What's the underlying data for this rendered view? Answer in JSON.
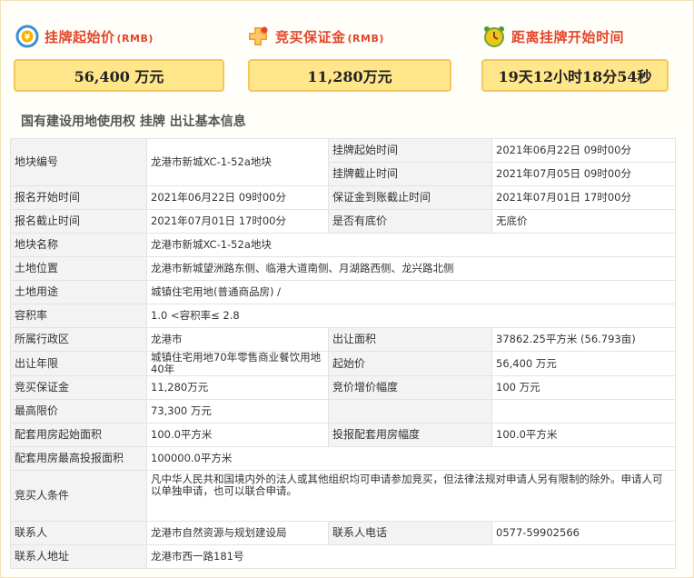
{
  "cards": [
    {
      "title": "挂牌起始价",
      "unit": "(RMB)",
      "value": "56,400 万元",
      "icon": "clock-money-icon"
    },
    {
      "title": "竞买保证金",
      "unit": "(RMB)",
      "value": "11,280万元",
      "icon": "deposit-cross-icon"
    },
    {
      "title": "距离挂牌开始时间",
      "unit": "",
      "value": "19天12小时18分54秒",
      "icon": "alarm-clock-icon"
    }
  ],
  "section_title": "国有建设用地使用权 挂牌 出让基本信息",
  "table": {
    "r1": {
      "l1": "地块编号",
      "v1": "龙港市新城XC-1-52a地块",
      "l2": "挂牌起始时间",
      "v2": "2021年06月22日 09时00分"
    },
    "r2": {
      "l2": "挂牌截止时间",
      "v2": "2021年07月05日 09时00分"
    },
    "r3": {
      "l1": "报名开始时间",
      "v1": "2021年06月22日 09时00分",
      "l2": "保证金到账截止时间",
      "v2": "2021年07月01日 17时00分"
    },
    "r4": {
      "l1": "报名截止时间",
      "v1": "2021年07月01日 17时00分",
      "l2": "是否有底价",
      "v2": "无底价"
    },
    "r5": {
      "l1": "地块名称",
      "v1": "龙港市新城XC-1-52a地块"
    },
    "r6": {
      "l1": "土地位置",
      "v1": "龙港市新城望洲路东侧、临港大道南侧、月湖路西侧、龙兴路北侧"
    },
    "r7": {
      "l1": "土地用途",
      "v1": "城镇住宅用地(普通商品房) /"
    },
    "r8": {
      "l1": "容积率",
      "v1": "1.0 <容积率≤ 2.8"
    },
    "r9": {
      "l1": "所属行政区",
      "v1": "龙港市",
      "l2": "出让面积",
      "v2": "37862.25平方米 (56.793亩)"
    },
    "r10": {
      "l1": "出让年限",
      "v1": "城镇住宅用地70年零售商业餐饮用地40年",
      "l2": "起始价",
      "v2": "56,400 万元"
    },
    "r11": {
      "l1": "竞买保证金",
      "v1": "11,280万元",
      "l2": "竞价增价幅度",
      "v2": "100 万元"
    },
    "r12": {
      "l1": "最高限价",
      "v1": "73,300 万元",
      "l2": "",
      "v2": ""
    },
    "r13": {
      "l1": "配套用房起始面积",
      "v1": "100.0平方米",
      "l2": "投报配套用房幅度",
      "v2": "100.0平方米"
    },
    "r14": {
      "l1": "配套用房最高投报面积",
      "v1": "100000.0平方米"
    },
    "r15": {
      "l1": "竞买人条件",
      "v1": "凡中华人民共和国境内外的法人或其他组织均可申请参加竞买，但法律法规对申请人另有限制的除外。申请人可以单独申请，也可以联合申请。"
    },
    "r16": {
      "l1": "联系人",
      "v1": "龙港市自然资源与规划建设局",
      "l2": "联系人电话",
      "v2": "0577-59902566"
    },
    "r17": {
      "l1": "联系人地址",
      "v1": "龙港市西一路181号"
    }
  }
}
